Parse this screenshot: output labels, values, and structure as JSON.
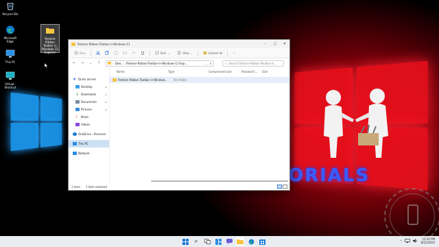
{
  "desktop": {
    "icons": [
      {
        "label": "Recycle Bin"
      },
      {
        "label": "Microsoft Edge"
      },
      {
        "label": "This PC"
      },
      {
        "label": "Virtual - Shortcut"
      },
      {
        "label": "Restore Ribbon Toolbar in Windows 11 Explorer"
      }
    ],
    "wallpaper_text": "ORIALS",
    "accent_blue": "#1a8fe0",
    "accent_red": "#e8101c"
  },
  "explorer": {
    "title": "Restore-Ribbon-Toolbar-in-Windows-11",
    "window_controls": {
      "minimize": "–",
      "maximize": "▢",
      "close": "✕"
    },
    "commandbar": {
      "new": "New",
      "sort": "Sort",
      "view": "View",
      "extract_all": "Extract all",
      "more": "···"
    },
    "address": {
      "crumb1": "Dow...",
      "crumb2": "Restore-Ribbon-Toolbar-in-Windows-11-Exp...",
      "search_placeholder": "Search Restore-Ribbon-Toolbar-in..."
    },
    "nav": {
      "quick_access": "Quick access",
      "desktop": "Desktop",
      "downloads": "Downloads",
      "documents": "Documents",
      "pictures": "Pictures",
      "music": "Music",
      "videos": "Videos",
      "onedrive": "OneDrive - Personal",
      "this_pc": "This PC",
      "network": "Network"
    },
    "columns": {
      "name": "Name",
      "type": "Type",
      "compressed_size": "Compressed size",
      "password": "Password ...",
      "size": "Size"
    },
    "rows": [
      {
        "name": "Restore Ribbon Toolbar in Window...",
        "type": "File folder"
      }
    ],
    "status": {
      "items": "1 item",
      "selected": "1 item selected"
    }
  },
  "taskbar": {
    "time": "12:54 PM",
    "date": "8/22/2022",
    "tray_chevron": "^"
  }
}
